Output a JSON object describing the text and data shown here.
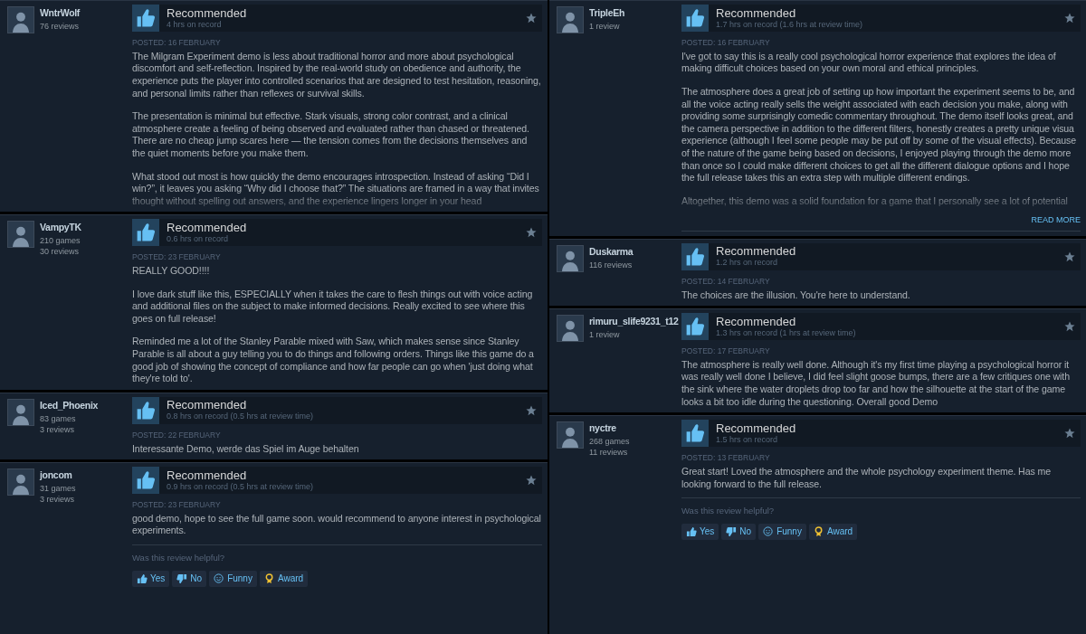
{
  "columns": [
    {
      "reviews": [
        {
          "user": "WntrWolf",
          "stats": [
            "76 reviews"
          ],
          "verdict": "Recommended",
          "hours": "4 hrs on record",
          "posted": "POSTED: 16 FEBRUARY",
          "faded": true,
          "paragraphs": [
            "The Milgram Experiment demo is less about traditional horror and more about psychological discomfort and self-reflection. Inspired by the real-world study on obedience and authority, the experience puts the player into controlled scenarios that are designed to test hesitation, reasoning, and personal limits rather than reflexes or survival skills.",
            "The presentation is minimal but effective. Stark visuals, strong color contrast, and a clinical atmosphere create a feeling of being observed and evaluated rather than chased or threatened. There are no cheap jump scares here — the tension comes from the decisions themselves and the quiet moments before you make them.",
            "What stood out most is how quickly the demo encourages introspection. Instead of asking “Did I win?”, it leaves you asking “Why did I choose that?” The situations are framed in a way that invites thought without spelling out answers, and the experience lingers longer in your head"
          ]
        },
        {
          "user": "VampyTK",
          "stats": [
            "210 games",
            "30 reviews"
          ],
          "verdict": "Recommended",
          "hours": "0.6 hrs on record",
          "posted": "POSTED: 23 FEBRUARY",
          "faded": false,
          "paragraphs": [
            "REALLY GOOD!!!!",
            "I love dark stuff like this, ESPECIALLY when it takes the care to flesh things out with voice acting and additional files on the subject to make informed decisions. Really excited to see where this goes on full release!",
            "Reminded me a lot of the Stanley Parable mixed with Saw, which makes sense since Stanley Parable is all about a guy telling you to do things and following orders. Things like this game do a good job of showing the concept of compliance and how far people can go when 'just doing what they're told to'."
          ]
        },
        {
          "user": "Iced_Phoenix",
          "stats": [
            "83 games",
            "3 reviews"
          ],
          "verdict": "Recommended",
          "hours": "0.8 hrs on record (0.5 hrs at review time)",
          "posted": "POSTED: 22 FEBRUARY",
          "faded": false,
          "paragraphs": [
            "Interessante Demo, werde das Spiel im Auge behalten"
          ]
        },
        {
          "user": "joncom",
          "stats": [
            "31 games",
            "3 reviews"
          ],
          "verdict": "Recommended",
          "hours": "0.9 hrs on record (0.5 hrs at review time)",
          "posted": "POSTED: 23 FEBRUARY",
          "faded": false,
          "paragraphs": [
            "good demo, hope to see the full game soon. would recommend to anyone interest in psychological experiments."
          ],
          "helpful": {
            "question": "Was this review helpful?",
            "buttons": [
              {
                "kind": "yes",
                "label": "Yes"
              },
              {
                "kind": "no",
                "label": "No"
              },
              {
                "kind": "funny",
                "label": "Funny"
              },
              {
                "kind": "award",
                "label": "Award"
              }
            ]
          }
        }
      ]
    },
    {
      "reviews": [
        {
          "user": "TripleEh",
          "stats": [
            "1 review"
          ],
          "verdict": "Recommended",
          "hours": "1.7 hrs on record (1.6 hrs at review time)",
          "posted": "POSTED: 16 FEBRUARY",
          "faded": true,
          "read_more": "READ MORE",
          "paragraphs": [
            "I've got to say this is a really cool psychological horror experience that explores the idea of making difficult choices based on your own moral and ethical principles.",
            "The atmosphere does a great job of setting up how important the experiment seems to be, and all the voice acting really sells the weight associated with each decision you make, along with providing some surprisingly comedic commentary throughout. The demo itself looks great, and the camera perspective in addition to the different filters, honestly creates a pretty unique visua experience (although I feel some people may be put off by some of the visual effects). Because of the nature of the game being based on decisions, I enjoyed playing through the demo more than once so I could make different choices to get all the different dialogue options and I hope the full release takes this an extra step with multiple different endings.",
            "Altogether, this demo was a solid foundation for a game that I personally see a lot of potential"
          ]
        },
        {
          "user": "Duskarma",
          "stats": [
            "116 reviews"
          ],
          "verdict": "Recommended",
          "hours": "1.2 hrs on record",
          "posted": "POSTED: 14 FEBRUARY",
          "faded": false,
          "paragraphs": [
            "The choices are the illusion. You're here to understand."
          ]
        },
        {
          "user": "rimuru_slife9231_t12",
          "stats": [
            "1 review"
          ],
          "verdict": "Recommended",
          "hours": "1.3 hrs on record (1 hrs at review time)",
          "posted": "POSTED: 17 FEBRUARY",
          "faded": false,
          "paragraphs": [
            "The atmosphere is really well done. Although it's my first time playing a psychological horror it was really well done I believe, I did feel slight goose bumps, there are a few critiques one with the sink where the water droplets drop too far and how the silhouette at the start of the game looks a bit too idle during the questioning. Overall good Demo"
          ]
        },
        {
          "user": "nyctre",
          "stats": [
            "268 games",
            "11 reviews"
          ],
          "verdict": "Recommended",
          "hours": "1.5 hrs on record",
          "posted": "POSTED: 13 FEBRUARY",
          "faded": false,
          "paragraphs": [
            "Great start! Loved the atmosphere and the whole psychology experiment theme. Has me looking forward to the full release."
          ],
          "helpful": {
            "question": "Was this review helpful?",
            "buttons": [
              {
                "kind": "yes",
                "label": "Yes"
              },
              {
                "kind": "no",
                "label": "No"
              },
              {
                "kind": "funny",
                "label": "Funny"
              },
              {
                "kind": "award",
                "label": "Award"
              }
            ]
          }
        }
      ]
    }
  ]
}
